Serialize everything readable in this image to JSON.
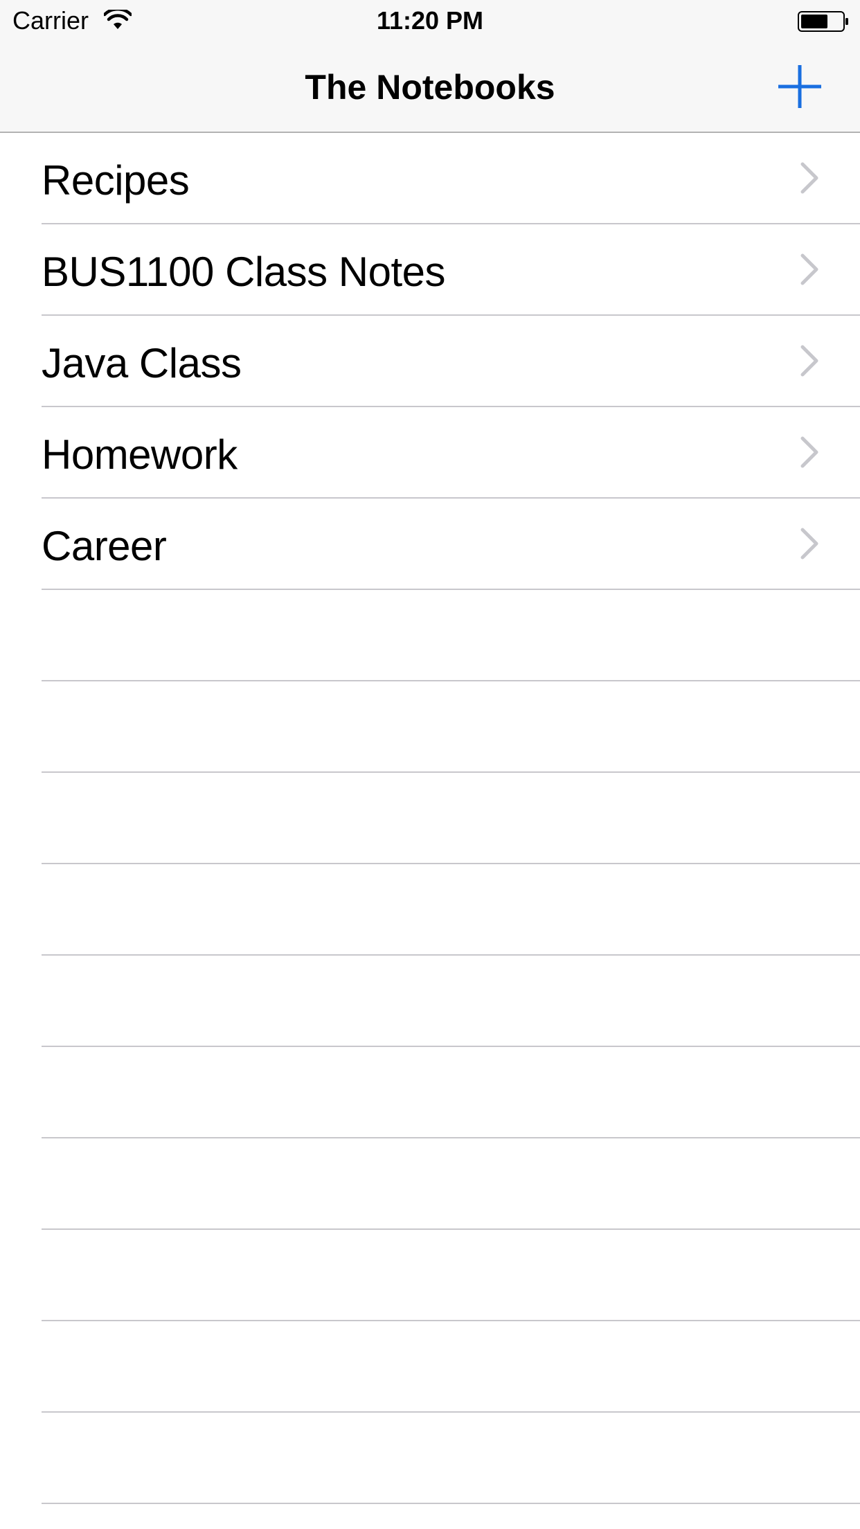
{
  "status_bar": {
    "carrier": "Carrier",
    "time": "11:20 PM",
    "wifi_icon": "wifi-icon",
    "battery_icon": "battery-icon"
  },
  "nav_bar": {
    "title": "The Notebooks",
    "add_icon": "plus-icon",
    "accent_color": "#1a6fe0"
  },
  "notebooks": [
    {
      "label": "Recipes"
    },
    {
      "label": "BUS1100 Class Notes"
    },
    {
      "label": "Java Class"
    },
    {
      "label": "Homework"
    },
    {
      "label": "Career"
    }
  ],
  "empty_rows": 10,
  "colors": {
    "nav_background": "#f7f7f7",
    "separator": "#c8c7cc",
    "chevron": "#c7c7cc",
    "text": "#000000"
  }
}
